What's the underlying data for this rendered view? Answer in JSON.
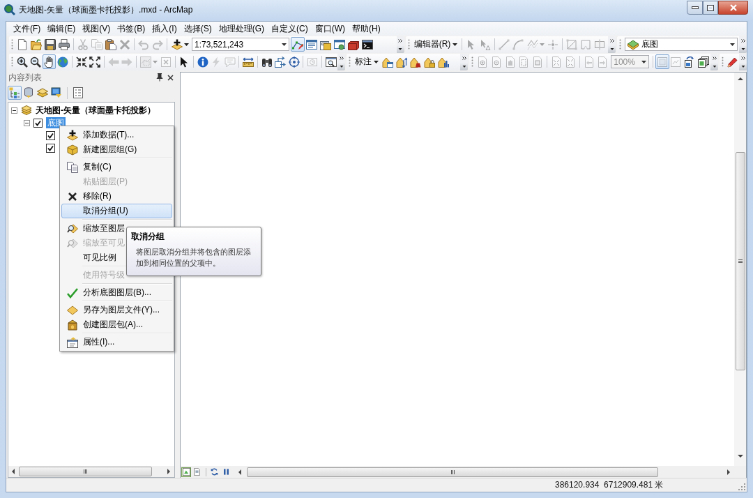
{
  "window": {
    "title": "天地图-矢量（球面墨卡托投影）.mxd - ArcMap"
  },
  "menu_bar": [
    "文件(F)",
    "编辑(E)",
    "视图(V)",
    "书签(B)",
    "插入(I)",
    "选择(S)",
    "地理处理(G)",
    "自定义(C)",
    "窗口(W)",
    "帮助(H)"
  ],
  "toolbar_rows": [
    [
      {
        "items": [
          {
            "kind": "button",
            "disabled": false,
            "selected": false
          },
          {
            "kind": "button",
            "disabled": false,
            "selected": false
          },
          {
            "kind": "button",
            "disabled": false,
            "selected": false
          },
          {
            "kind": "button",
            "disabled": false,
            "selected": false
          },
          {
            "kind": "button",
            "disabled": true,
            "selected": false
          },
          {
            "kind": "button",
            "disabled": true,
            "selected": false
          },
          {
            "kind": "button",
            "disabled": false,
            "selected": false
          },
          {
            "kind": "button",
            "disabled": true,
            "selected": false
          },
          {
            "kind": "button",
            "disabled": true,
            "selected": false
          },
          {
            "kind": "button",
            "disabled": true,
            "selected": false
          },
          {
            "kind": "dropdown",
            "disabled": false,
            "selected": false
          },
          {
            "kind": "combo",
            "value": "1:73,521,243",
            "disabled": false
          },
          {
            "kind": "button",
            "disabled": false,
            "selected": true
          },
          {
            "kind": "button",
            "disabled": false,
            "selected": false
          },
          {
            "kind": "button",
            "disabled": false,
            "selected": false
          },
          {
            "kind": "button",
            "disabled": false,
            "selected": false
          },
          {
            "kind": "button",
            "disabled": false,
            "selected": false
          },
          {
            "kind": "button",
            "disabled": false,
            "selected": false
          }
        ]
      },
      {
        "items": [
          {
            "kind": "menu",
            "label": "编辑器(R)"
          },
          {
            "kind": "button",
            "disabled": true,
            "selected": false
          },
          {
            "kind": "button",
            "disabled": true,
            "selected": false
          },
          {
            "kind": "button",
            "disabled": true,
            "selected": false
          },
          {
            "kind": "button",
            "disabled": true,
            "selected": false
          },
          {
            "kind": "dropdown",
            "disabled": true,
            "selected": false
          },
          {
            "kind": "button",
            "disabled": true,
            "selected": false
          },
          {
            "kind": "button",
            "disabled": true,
            "selected": false
          },
          {
            "kind": "button",
            "disabled": true,
            "selected": false
          },
          {
            "kind": "button",
            "disabled": true,
            "selected": false
          }
        ]
      },
      {
        "items": [
          {
            "kind": "combo",
            "value": "底图",
            "disabled": false
          }
        ]
      }
    ],
    [
      {
        "items": [
          {
            "kind": "button",
            "disabled": false,
            "selected": false
          },
          {
            "kind": "button",
            "disabled": false,
            "selected": false
          },
          {
            "kind": "button",
            "disabled": false,
            "selected": true
          },
          {
            "kind": "button",
            "disabled": false,
            "selected": false
          },
          {
            "kind": "button",
            "disabled": false,
            "selected": false
          },
          {
            "kind": "button",
            "disabled": false,
            "selected": false
          },
          {
            "kind": "button",
            "disabled": true,
            "selected": false
          },
          {
            "kind": "button",
            "disabled": true,
            "selected": false
          },
          {
            "kind": "dropdown",
            "disabled": true,
            "selected": false
          },
          {
            "kind": "button",
            "disabled": true,
            "selected": false
          },
          {
            "kind": "button",
            "disabled": false,
            "selected": false
          },
          {
            "kind": "button",
            "disabled": false,
            "selected": false
          },
          {
            "kind": "button",
            "disabled": true,
            "selected": false
          },
          {
            "kind": "button",
            "disabled": true,
            "selected": false
          },
          {
            "kind": "button",
            "disabled": false,
            "selected": false
          },
          {
            "kind": "button",
            "disabled": false,
            "selected": false
          },
          {
            "kind": "button",
            "disabled": false,
            "selected": false
          },
          {
            "kind": "button",
            "disabled": false,
            "selected": false
          },
          {
            "kind": "button",
            "disabled": true,
            "selected": false
          },
          {
            "kind": "button",
            "disabled": false,
            "selected": false
          }
        ]
      },
      {
        "items": [
          {
            "kind": "menu",
            "label": "标注"
          },
          {
            "kind": "button",
            "disabled": false,
            "selected": false
          },
          {
            "kind": "button",
            "disabled": false,
            "selected": false
          },
          {
            "kind": "button",
            "disabled": false,
            "selected": false
          },
          {
            "kind": "button",
            "disabled": false,
            "selected": false
          },
          {
            "kind": "button",
            "disabled": false,
            "selected": false
          }
        ]
      },
      {
        "items": [
          {
            "kind": "button",
            "disabled": true,
            "selected": false
          },
          {
            "kind": "button",
            "disabled": true,
            "selected": false
          },
          {
            "kind": "button",
            "disabled": true,
            "selected": false
          },
          {
            "kind": "button",
            "disabled": true,
            "selected": false
          },
          {
            "kind": "button",
            "disabled": true,
            "selected": false
          },
          {
            "kind": "button",
            "disabled": true,
            "selected": false
          },
          {
            "kind": "button",
            "disabled": true,
            "selected": false
          },
          {
            "kind": "button",
            "disabled": true,
            "selected": false
          },
          {
            "kind": "button",
            "disabled": true,
            "selected": false
          },
          {
            "kind": "combo",
            "value": "100%",
            "disabled": true
          },
          {
            "kind": "button",
            "disabled": true,
            "selected": true
          },
          {
            "kind": "button",
            "disabled": true,
            "selected": false
          },
          {
            "kind": "button",
            "disabled": false,
            "selected": false
          },
          {
            "kind": "button",
            "disabled": false,
            "selected": false
          }
        ]
      },
      {
        "items": [
          {
            "kind": "button",
            "disabled": false,
            "selected": false
          }
        ]
      }
    ]
  ],
  "table_of_contents": {
    "title": "内容列表",
    "tools": [
      {
        "selected": true
      },
      {
        "selected": false
      },
      {
        "selected": false
      },
      {
        "selected": false
      },
      {
        "selected": false
      }
    ],
    "tree": [
      {
        "name": "天地图-矢量（球面墨卡托投影）",
        "expanded": true,
        "selected": false,
        "children": [
          {
            "name": "底图",
            "checked": true,
            "expanded": true,
            "selected": true,
            "children": [
              {
                "checked": true
              },
              {
                "checked": true
              }
            ]
          }
        ]
      }
    ]
  },
  "map_view": {
    "view_buttons": [
      {
        "selected": true
      },
      {
        "selected": false
      }
    ]
  },
  "context_menu": {
    "groups": [
      [
        {
          "label": "添加数据(T)...",
          "disabled": false,
          "selected": false
        },
        {
          "label": "新建图层组(G)",
          "disabled": false,
          "selected": false
        }
      ],
      [
        {
          "label": "复制(C)",
          "disabled": false,
          "selected": false
        },
        {
          "label": "粘贴图层(P)",
          "disabled": true,
          "selected": false
        },
        {
          "label": "移除(R)",
          "disabled": false,
          "selected": false
        },
        {
          "label": "取消分组(U)",
          "disabled": false,
          "selected": true
        }
      ],
      [
        {
          "label": "缩放至图层",
          "disabled": false,
          "selected": false
        },
        {
          "label": "缩放至可见",
          "disabled": true,
          "selected": false
        },
        {
          "label": "可见比例",
          "disabled": false,
          "selected": false
        }
      ],
      [
        {
          "label": "使用符号级",
          "disabled": true,
          "selected": false
        }
      ],
      [
        {
          "label": "分析底图图层(B)...",
          "disabled": false,
          "selected": false
        }
      ],
      [
        {
          "label": "另存为图层文件(Y)...",
          "disabled": false,
          "selected": false
        },
        {
          "label": "创建图层包(A)...",
          "disabled": false,
          "selected": false
        }
      ],
      [
        {
          "label": "属性(I)...",
          "disabled": false,
          "selected": false
        }
      ]
    ]
  },
  "tooltip": {
    "title": "取消分组",
    "text": "将图层取消分组并将包含的图层添加到相同位置的父项中。"
  },
  "status_bar": {
    "coordinates": "386120.934  6712909.481 米"
  }
}
